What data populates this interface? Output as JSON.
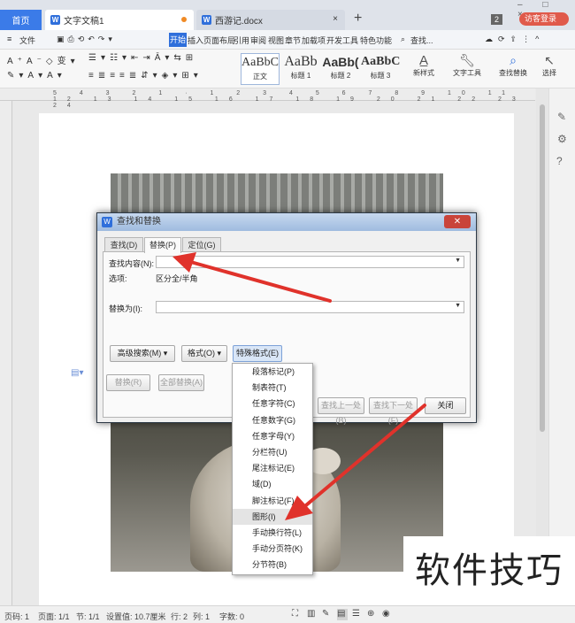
{
  "tabs": {
    "home": "首页",
    "doc1": "文字文稿1",
    "doc2": "西游记.docx",
    "count": "2",
    "visitor": "访客登录"
  },
  "menubar": {
    "file": "文件",
    "start": "开始",
    "items": [
      "插入",
      "页面布局",
      "引用",
      "审阅",
      "视图",
      "章节",
      "加载项",
      "开发工具",
      "特色功能"
    ],
    "search": "查找..."
  },
  "ribbon": {
    "styles": [
      {
        "sample": "AaBbCc",
        "name": "正文"
      },
      {
        "sample": "AaBb",
        "name": "标题 1"
      },
      {
        "sample": "AaBb(",
        "name": "标题 2"
      },
      {
        "sample": "AaBbCc",
        "name": "标题 3"
      }
    ],
    "new_style": "新样式",
    "text_tools": "文字工具",
    "find_replace": "查找替换",
    "select": "选择"
  },
  "dialog": {
    "title": "查找和替换",
    "tabs": [
      "查找(D)",
      "替换(P)",
      "定位(G)"
    ],
    "find_label": "查找内容(N):",
    "options_label": "选项:",
    "options_value": "区分全/半角",
    "replace_label": "替换为(I):",
    "btn_advanced": "高级搜索(M)",
    "btn_format": "格式(O)",
    "btn_special": "特殊格式(E)",
    "btn_replace": "替换(R)",
    "btn_replace_all": "全部替换(A)",
    "btn_find_prev": "查找上一处(B)",
    "btn_find_next": "查找下一处(F)",
    "btn_close": "关闭"
  },
  "special_menu": [
    "段落标记(P)",
    "制表符(T)",
    "任意字符(C)",
    "任意数字(G)",
    "任意字母(Y)",
    "分栏符(U)",
    "尾注标记(E)",
    "域(D)",
    "脚注标记(F)",
    "图形(I)",
    "手动换行符(L)",
    "手动分页符(K)",
    "分节符(B)"
  ],
  "status": {
    "page": "页码: 1",
    "pages": "页面: 1/1",
    "section": "节: 1/1",
    "setting": "设置值: 10.7厘米",
    "row": "行: 2",
    "col": "列: 1",
    "words": "字数: 0"
  },
  "watermark": "软件技巧",
  "colors": {
    "accent": "#2f6fdb",
    "arrow": "#e0322b",
    "close": "#c9443a"
  }
}
